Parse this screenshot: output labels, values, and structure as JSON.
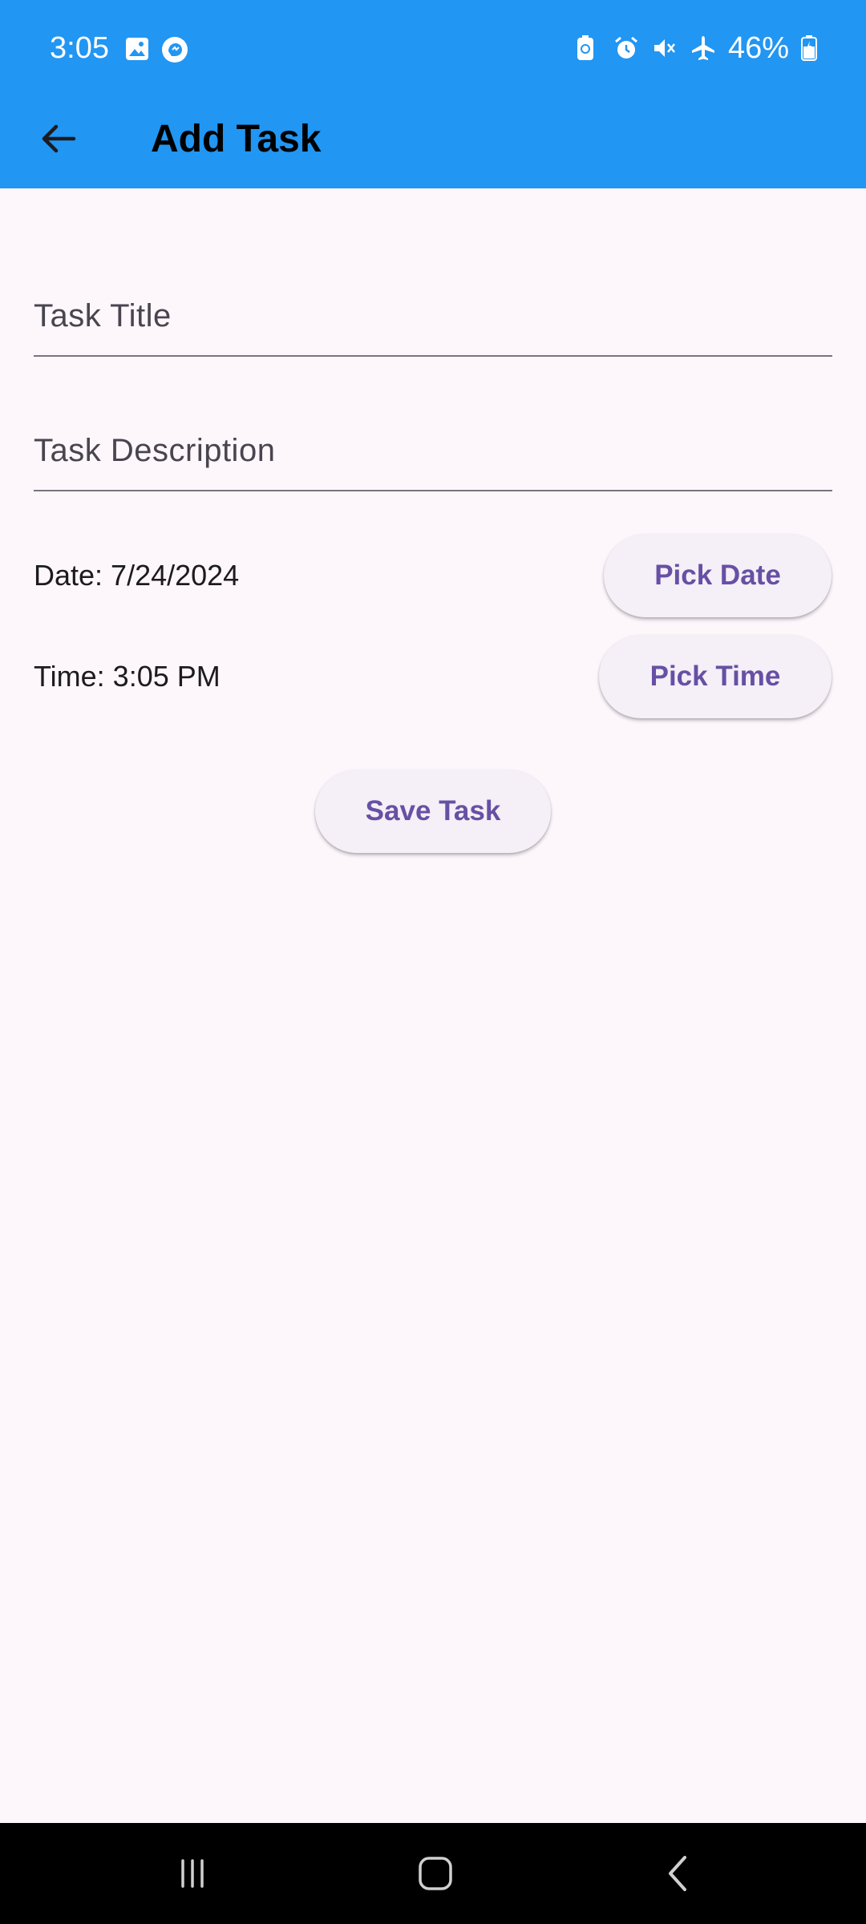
{
  "status_bar": {
    "time": "3:05",
    "battery": "46%",
    "left_icons": [
      "gallery-icon",
      "messenger-icon"
    ],
    "right_icons": [
      "battery-saver-icon",
      "alarm-icon",
      "mute-icon",
      "airplane-icon",
      "battery-icon"
    ]
  },
  "app_bar": {
    "title": "Add Task",
    "background": "#2196f3"
  },
  "form": {
    "title_placeholder": "Task Title",
    "title_value": "",
    "description_placeholder": "Task Description",
    "description_value": "",
    "date_label": "Date: 7/24/2024",
    "pick_date_label": "Pick Date",
    "time_label": "Time: 3:05 PM",
    "pick_time_label": "Pick Time",
    "save_label": "Save Task"
  },
  "colors": {
    "accent": "#6750a4",
    "button_bg": "#f5eff7",
    "page_bg": "#fdf7fc"
  },
  "nav_bar": {
    "icons": [
      "recent-apps-icon",
      "home-icon",
      "back-nav-icon"
    ]
  }
}
